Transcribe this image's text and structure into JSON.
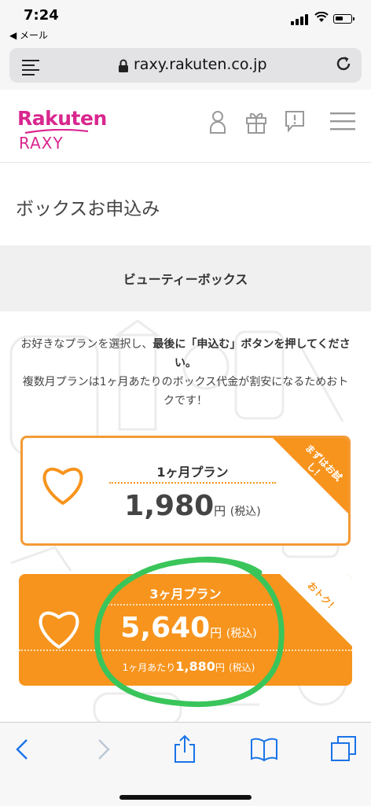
{
  "status": {
    "time": "7:24",
    "back_label": "◀ メール"
  },
  "browser": {
    "url": "raxy.rakuten.co.jp"
  },
  "header": {
    "logo_top": "Rakuten",
    "logo_bottom": "RAXY"
  },
  "page": {
    "title": "ボックスお申込み",
    "section": "ビューティーボックス"
  },
  "intro": {
    "line1_a": "お好きなプランを選択し、",
    "line1_b": "最後に「申込む」ボタンを押してください。",
    "line2": "複数月プランは1ヶ月あたりのボックス代金が割安になるためおトクです！"
  },
  "plans": [
    {
      "name": "1ヶ月プラン",
      "price": "1,980",
      "yen": "円",
      "tax": "(税込)",
      "ribbon": "まずはお試し！"
    },
    {
      "name": "3ヶ月プラン",
      "price": "5,640",
      "yen": "円",
      "tax": "(税込)",
      "ribbon": "おトク！",
      "per_month_label": "1ヶ月あたり",
      "per_month_price": "1,880",
      "per_month_yen": "円",
      "per_month_tax": "(税込)"
    }
  ],
  "colors": {
    "accent": "#f7941d",
    "brand": "#d9278f",
    "ios_blue": "#1a73e8",
    "annotation": "#39c55a"
  }
}
